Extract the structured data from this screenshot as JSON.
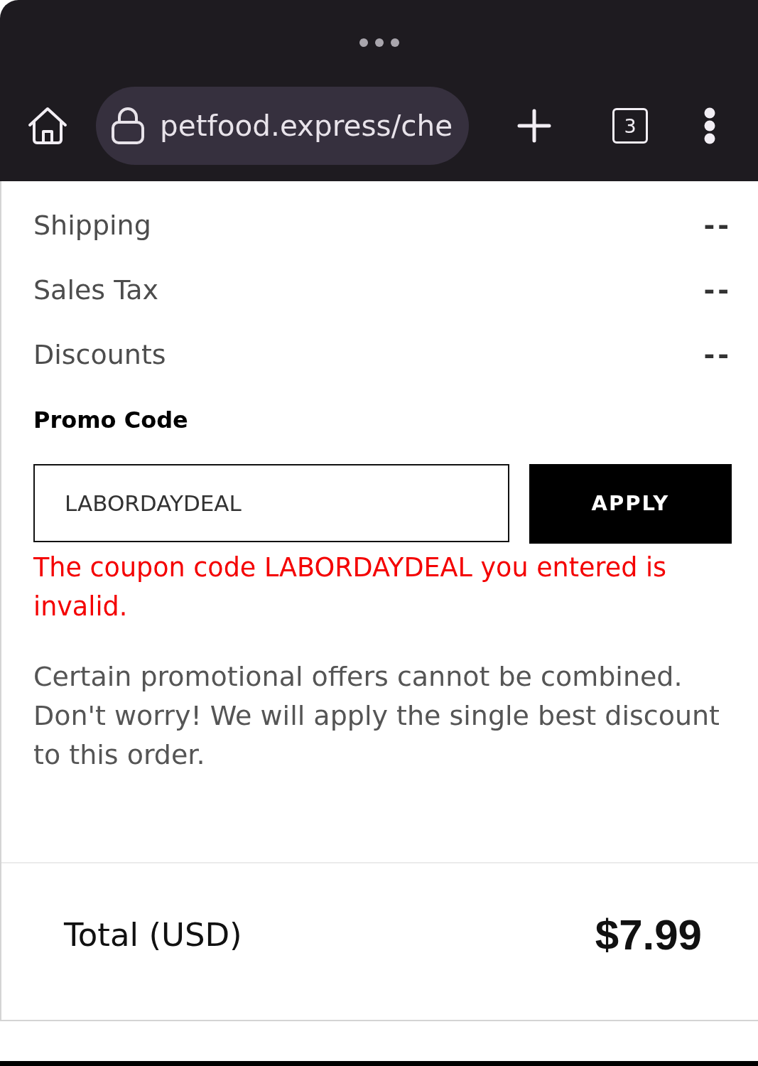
{
  "browser": {
    "url": "petfood.express/che",
    "tab_count": "3"
  },
  "summary_rows": [
    {
      "label": "Shipping",
      "value": "--"
    },
    {
      "label": "Sales Tax",
      "value": "--"
    },
    {
      "label": "Discounts",
      "value": "--"
    }
  ],
  "promo": {
    "label": "Promo Code",
    "value": "LABORDAYDEAL",
    "button": "APPLY",
    "error": "The coupon code LABORDAYDEAL you entered is invalid."
  },
  "note": "Certain promotional offers cannot be combined. Don't worry! We will apply the single best discount to this order.",
  "total": {
    "label": "Total (USD)",
    "amount": "$7.99"
  }
}
